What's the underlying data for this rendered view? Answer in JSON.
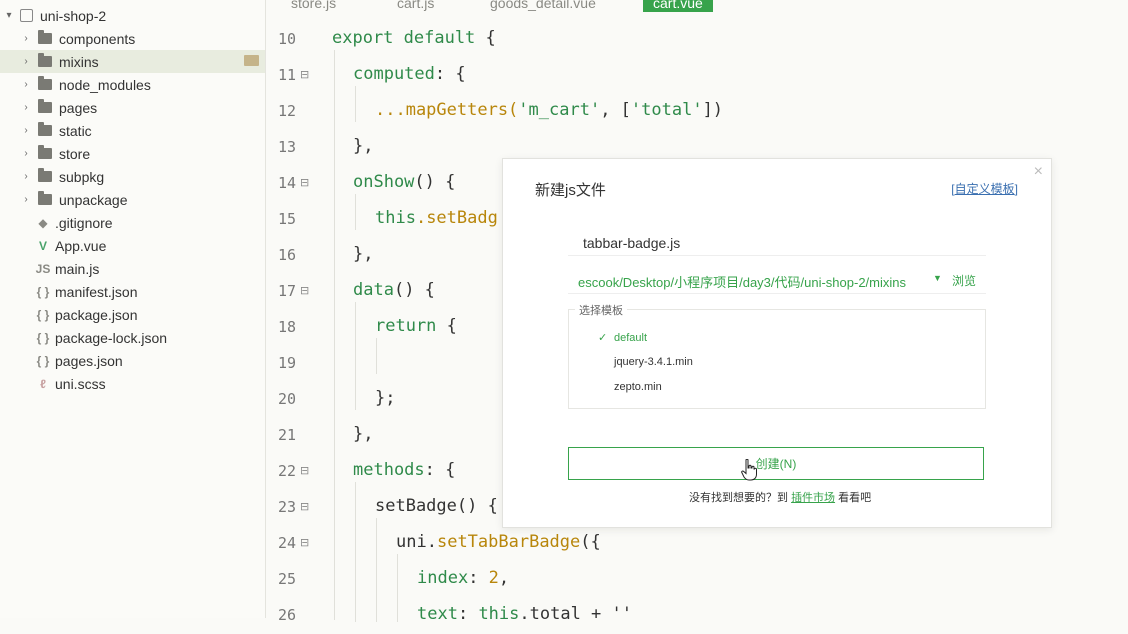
{
  "sidebar": {
    "project": "uni-shop-2",
    "items": [
      {
        "label": "components",
        "kind": "folder"
      },
      {
        "label": "mixins",
        "kind": "folder"
      },
      {
        "label": "node_modules",
        "kind": "folder"
      },
      {
        "label": "pages",
        "kind": "folder"
      },
      {
        "label": "static",
        "kind": "folder"
      },
      {
        "label": "store",
        "kind": "folder"
      },
      {
        "label": "subpkg",
        "kind": "folder"
      },
      {
        "label": "unpackage",
        "kind": "folder"
      },
      {
        "label": ".gitignore",
        "kind": "file",
        "icon": "◆"
      },
      {
        "label": "App.vue",
        "kind": "file",
        "icon": "V"
      },
      {
        "label": "main.js",
        "kind": "file",
        "icon": "JS"
      },
      {
        "label": "manifest.json",
        "kind": "file",
        "icon": "{ }"
      },
      {
        "label": "package.json",
        "kind": "file",
        "icon": "{ }"
      },
      {
        "label": "package-lock.json",
        "kind": "file",
        "icon": "{ }"
      },
      {
        "label": "pages.json",
        "kind": "file",
        "icon": "{ }"
      },
      {
        "label": "uni.scss",
        "kind": "file",
        "icon": "ℓ"
      }
    ],
    "selected": "mixins"
  },
  "tabs": [
    "store.js",
    "cart.js",
    "goods_detail.vue",
    "cart.vue"
  ],
  "active_tab": "cart.vue",
  "code": {
    "line_numbers": [
      "10",
      "11",
      "12",
      "13",
      "14",
      "15",
      "16",
      "17",
      "18",
      "19",
      "20",
      "21",
      "22",
      "23",
      "24",
      "25",
      "26"
    ],
    "l10": {
      "kw": "export default",
      "rest": " {"
    },
    "l11": {
      "a": "computed",
      "b": ": {"
    },
    "l12": {
      "a": "...mapGetters(",
      "s1": "'m_cart'",
      "b": ", [",
      "s2": "'total'",
      "c": "])"
    },
    "l13": {
      "a": "},"
    },
    "l14": {
      "a": "onShow",
      "b": "() {"
    },
    "l15": {
      "a": "this",
      "b": ".setBadg"
    },
    "l16": {
      "a": "},"
    },
    "l17": {
      "a": "data",
      "b": "() {"
    },
    "l18": {
      "a": "return",
      "b": " {"
    },
    "l20": {
      "a": "};"
    },
    "l21": {
      "a": "},"
    },
    "l22": {
      "a": "methods",
      "b": ": {"
    },
    "l23": {
      "a": "setBadge",
      "b": "() {"
    },
    "l24": {
      "a": "uni",
      "b": ".",
      "c": "setTabBarBadge",
      "d": "({"
    },
    "l25": {
      "a": "index",
      "b": ": ",
      "n": "2",
      "c": ","
    },
    "l26": {
      "a": "text",
      "b": ": ",
      "c": "this",
      "d": ".total + ''"
    }
  },
  "dialog": {
    "title": "新建js文件",
    "custom_template_bracket_open": "[",
    "custom_template_link": "自定义模板",
    "custom_template_bracket_close": "]",
    "filename": "tabbar-badge.js",
    "path": "escook/Desktop/小程序项目/day3/代码/uni-shop-2/mixins",
    "browse": "浏览",
    "template_legend": "选择模板",
    "templates": [
      "default",
      "jquery-3.4.1.min",
      "zepto.min"
    ],
    "selected_template": "default",
    "create_button": "创建(N)",
    "footer_prefix": "没有找到想要的？到 ",
    "footer_link": "插件市场",
    "footer_suffix": " 看看吧",
    "close_glyph": "×"
  },
  "colors": {
    "accent": "#37a34b",
    "sidebar_bg": "#fbfbf8",
    "editor_bg": "#fafaf7"
  }
}
